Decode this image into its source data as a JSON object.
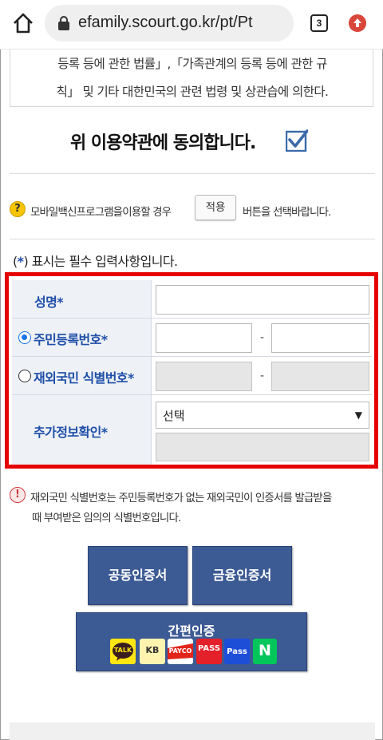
{
  "browser": {
    "url": "efamily.scourt.go.kr/pt/Pt",
    "tab_count": "3",
    "home_icon": "home-icon",
    "lock_icon": "lock-icon",
    "update_icon": "update-arrow-icon"
  },
  "terms": {
    "line1": "등록 등에 관한 법률」,「가족관계의 등록 등에 관한 규",
    "line2": "칙」 및 기타 대한민국의 관련 법령 및 상관습에 의한다."
  },
  "agree": {
    "text": "위 이용약관에 동의합니다.",
    "checked": true
  },
  "mobile_notice": {
    "before": "모바일백신프로그램을이용할 경우",
    "apply_label": "적용",
    "after": "버튼을 선택바랍니다."
  },
  "required_note": {
    "open": "(",
    "star": "*",
    "rest": ") 표시는 필수 입력사항입니다."
  },
  "form": {
    "name_label": "성명",
    "rrn_label": "주민등록번호",
    "foreign_label": "재외국민 식별번호",
    "extra_label": "추가정보확인",
    "star": "*",
    "dash": "-",
    "extra_select_value": "선택",
    "select_arrow": "▼",
    "rrn_selected": true
  },
  "warning": {
    "line1": "재외국민 식별번호는 주민등록번호가 없는 재외국민이 인증서를 발급받을",
    "line2": "때 부여받은 임의의 식별번호입니다."
  },
  "auth": {
    "public_cert": "공동인증서",
    "finance_cert": "금융인증서",
    "simple_auth": "간편인증",
    "providers": [
      "TALK",
      "KB",
      "PAYCO",
      "PASS",
      "Pass",
      "N"
    ]
  },
  "colors": {
    "accent_blue": "#1f4fa8",
    "navy_button": "#3c5a93",
    "highlight_red": "#e60000"
  }
}
